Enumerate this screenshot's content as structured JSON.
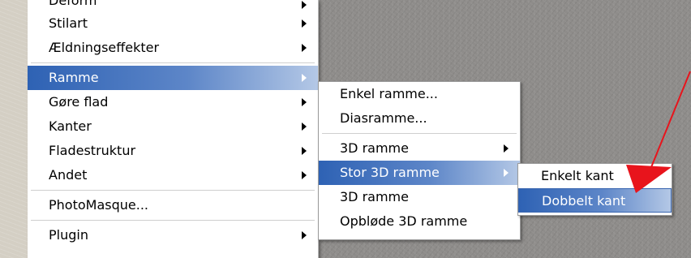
{
  "main_menu": {
    "items": [
      {
        "label": "Deform",
        "arrow": true
      },
      {
        "label": "Stilart",
        "arrow": true
      },
      {
        "label": "Ældningseffekter",
        "arrow": true
      },
      {
        "label": "Ramme",
        "arrow": true,
        "highlighted": true
      },
      {
        "label": "Gøre flad",
        "arrow": true
      },
      {
        "label": "Kanter",
        "arrow": true
      },
      {
        "label": "Fladestruktur",
        "arrow": true
      },
      {
        "label": "Andet",
        "arrow": true
      },
      {
        "label": "PhotoMasque...",
        "arrow": false
      },
      {
        "label": "Plugin",
        "arrow": true
      }
    ]
  },
  "submenu_ramme": {
    "items": [
      {
        "label": "Enkel ramme...",
        "arrow": false
      },
      {
        "label": "Diasramme...",
        "arrow": false
      },
      {
        "label": "3D ramme",
        "arrow": true
      },
      {
        "label": "Stor 3D ramme",
        "arrow": true,
        "highlighted": true
      },
      {
        "label": "3D ramme",
        "arrow": false
      },
      {
        "label": "Opbløde 3D ramme",
        "arrow": false
      }
    ]
  },
  "submenu_stor3d": {
    "items": [
      {
        "label": "Enkelt kant",
        "arrow": false
      },
      {
        "label": "Dobbelt kant",
        "arrow": false,
        "highlighted": true
      }
    ]
  },
  "colors": {
    "highlight_start": "#2e62b4",
    "highlight_end": "#b4c8e6",
    "annotation_red": "#e8141c"
  },
  "annotation": {
    "icon": "red-arrow-pointer-icon"
  }
}
